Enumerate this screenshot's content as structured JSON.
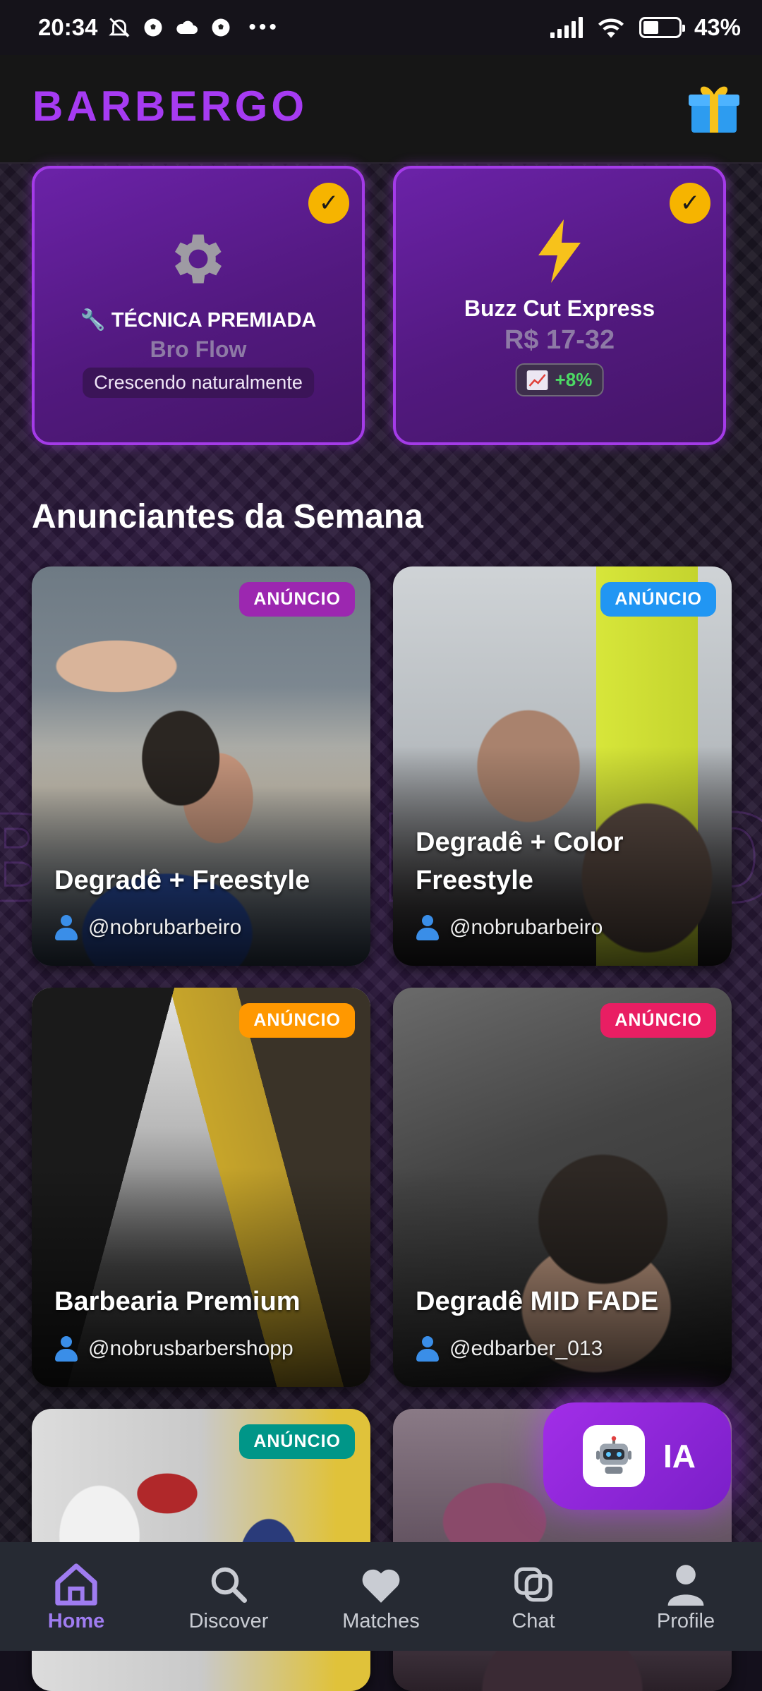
{
  "status_bar": {
    "time": "20:34",
    "battery": "43%",
    "battery_fraction": 0.43
  },
  "app": {
    "brand": "BARBERGO"
  },
  "top_cards": [
    {
      "title": "TÉCNICA PREMIADA",
      "subtitle": "Bro Flow",
      "pill": "Crescendo naturalmente",
      "icon": "gear-icon",
      "tool_icon": "wrench-icon",
      "checked": true
    },
    {
      "title": "Buzz Cut Express",
      "price": "R$ 17-32",
      "trend": "+8%",
      "icon": "lightning-icon",
      "checked": true
    }
  ],
  "section": {
    "title": "Anunciantes da Semana"
  },
  "ads": [
    {
      "badge": "ANÚNCIO",
      "badge_color": "#9c27b0",
      "title": "Degradê + Freestyle",
      "user": "@nobrubarbeiro"
    },
    {
      "badge": "ANÚNCIO",
      "badge_color": "#2196f3",
      "title": "Degradê + Color Freestyle",
      "user": "@nobrubarbeiro"
    },
    {
      "badge": "ANÚNCIO",
      "badge_color": "#ff9800",
      "title": "Barbearia Premium",
      "user": "@nobrusbarbershopp"
    },
    {
      "badge": "ANÚNCIO",
      "badge_color": "#e91e63",
      "title": "Degradê MID FADE",
      "user": "@edbarber_013"
    },
    {
      "badge": "ANÚNCIO",
      "badge_color": "#009688"
    }
  ],
  "fab": {
    "label": "IA"
  },
  "nav": [
    {
      "label": "Home",
      "icon": "home-icon",
      "active": true
    },
    {
      "label": "Discover",
      "icon": "search-icon"
    },
    {
      "label": "Matches",
      "icon": "heart-icon"
    },
    {
      "label": "Chat",
      "icon": "chat-icon"
    },
    {
      "label": "Profile",
      "icon": "person-icon"
    }
  ],
  "colors": {
    "accent": "#a63bf2",
    "check": "#f6b400",
    "nav_active": "#9f7cf0"
  }
}
